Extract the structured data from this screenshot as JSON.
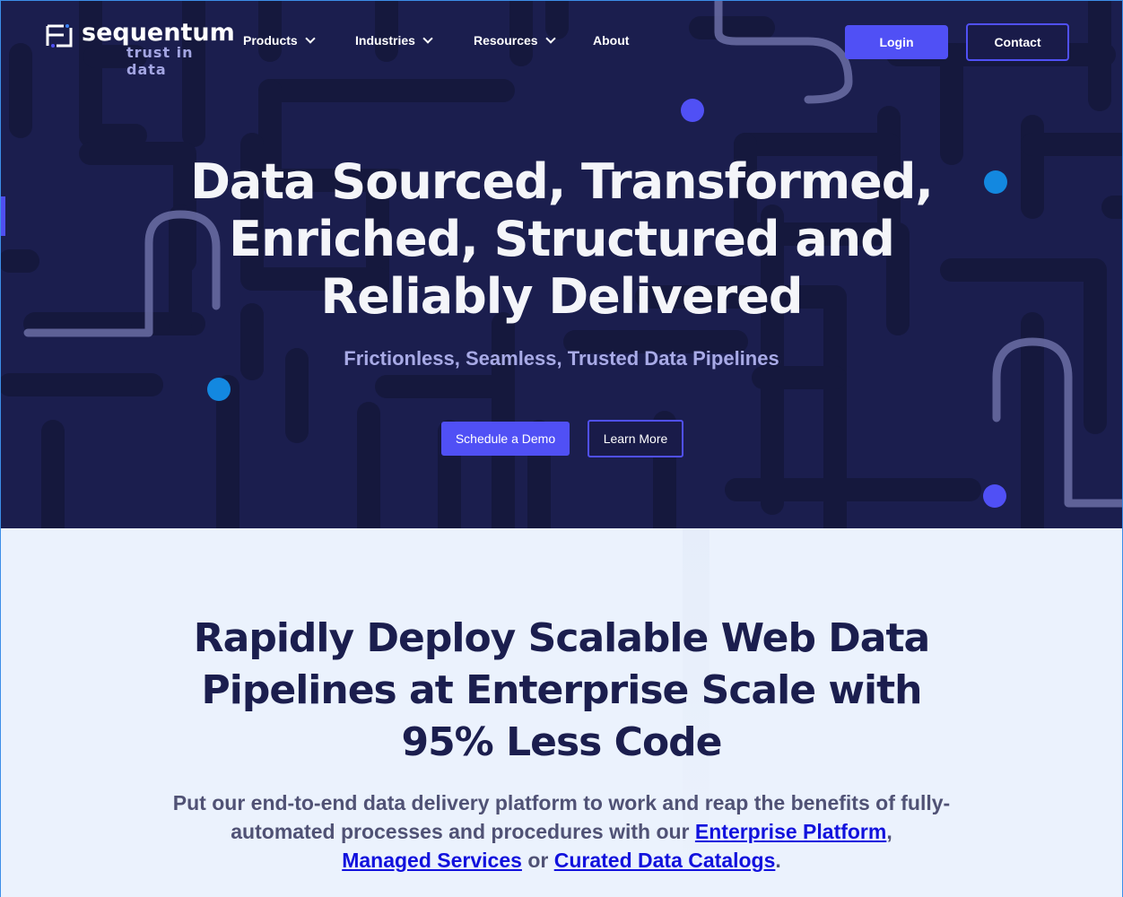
{
  "brand": {
    "name": "sequentum",
    "tagline": "trust in data"
  },
  "nav": {
    "items": [
      {
        "label": "Products",
        "has_dropdown": true
      },
      {
        "label": "Industries",
        "has_dropdown": true
      },
      {
        "label": "Resources",
        "has_dropdown": true
      },
      {
        "label": "About",
        "has_dropdown": false
      }
    ],
    "login_label": "Login",
    "contact_label": "Contact"
  },
  "hero": {
    "title_lines": [
      "Data Sourced, Transformed,",
      "Enriched, Structured and",
      "Reliably Delivered"
    ],
    "subtitle": "Frictionless, Seamless, Trusted Data Pipelines",
    "primary_cta": "Schedule a Demo",
    "secondary_cta": "Learn More"
  },
  "section2": {
    "title_lines": [
      "Rapidly Deploy Scalable Web Data",
      "Pipelines at Enterprise Scale with",
      "95% Less Code"
    ],
    "body_intro": "Put our end-to-end data delivery platform to work and reap the benefits of fully-automated processes and procedures with our ",
    "link1": "Enterprise Platform",
    "sep1": ",",
    "link2": "Managed Services",
    "sep2": " or ",
    "link3": "Curated Data Catalogs",
    "end": "."
  },
  "colors": {
    "hero_bg": "#1b1e4e",
    "accent": "#5050f5",
    "subtitle": "#a8aae6",
    "dot_blue": "#1388e0",
    "dot_purple": "#5050f5",
    "section_bg": "#ebf2fd",
    "heading_dark": "#1b1e4e",
    "link": "#1111dd"
  }
}
